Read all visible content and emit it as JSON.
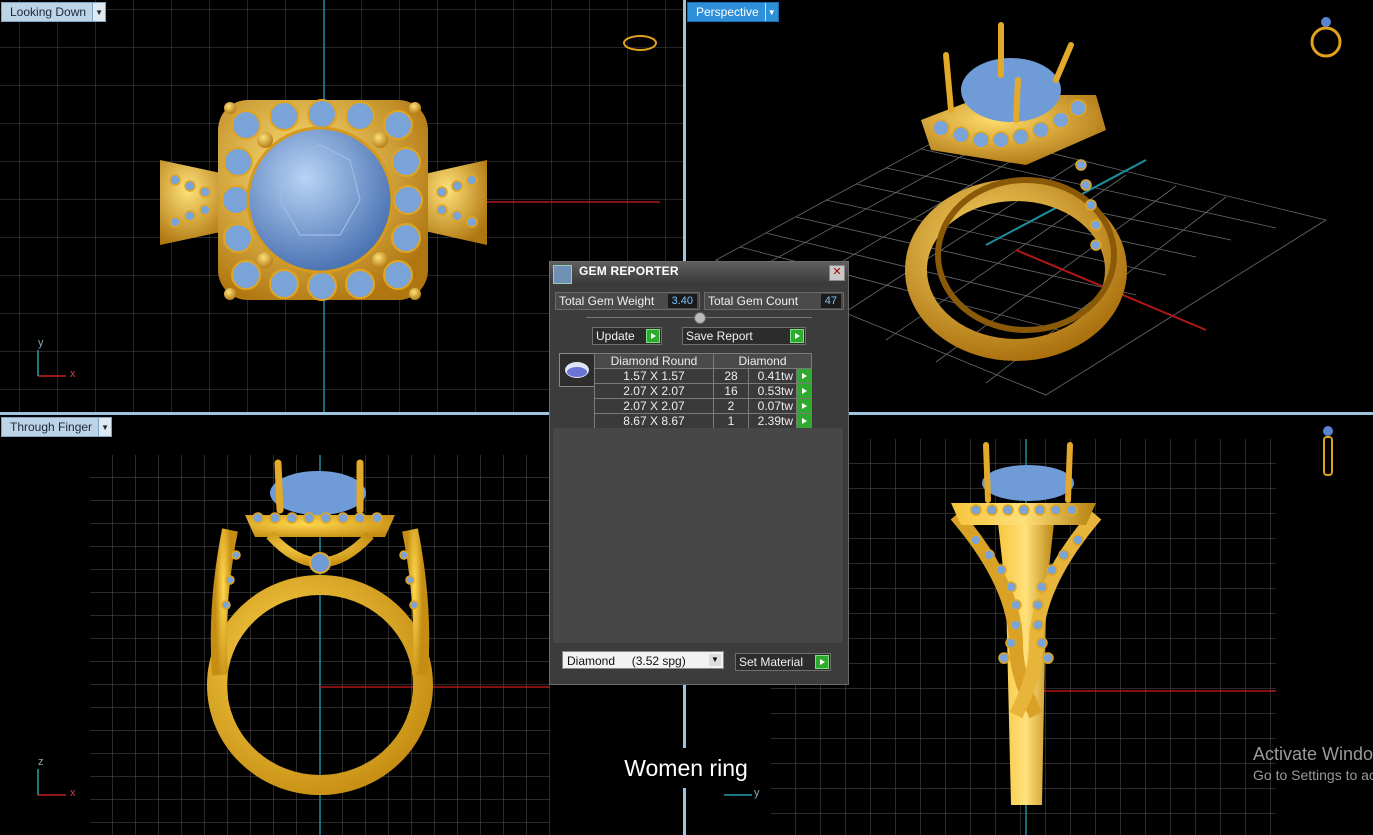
{
  "viewports": {
    "top": {
      "label": "Looking Down"
    },
    "perspective": {
      "label": "Perspective"
    },
    "front": {
      "label": "Through Finger"
    },
    "side": {
      "label": ""
    }
  },
  "axes": {
    "top": {
      "x": "x",
      "y": "y"
    },
    "front": {
      "x": "x",
      "z": "z"
    },
    "side": {
      "y": "y"
    }
  },
  "gem_reporter": {
    "title": "GEM REPORTER",
    "total_weight_label": "Total Gem Weight",
    "total_weight_value": "3.40",
    "total_count_label": "Total Gem Count",
    "total_count_value": "47",
    "update_label": "Update",
    "save_report_label": "Save Report",
    "table": {
      "headers": [
        "Diamond Round",
        "Diamond"
      ],
      "rows": [
        {
          "size": "1.57 X 1.57",
          "count": "28",
          "weight": "0.41tw"
        },
        {
          "size": "2.07 X 2.07",
          "count": "16",
          "weight": "0.53tw"
        },
        {
          "size": "2.07 X 2.07",
          "count": "2",
          "weight": "0.07tw"
        },
        {
          "size": "8.67 X 8.67",
          "count": "1",
          "weight": "2.39tw"
        }
      ]
    },
    "material_select": "Diamond     (3.52 spg)",
    "set_material_label": "Set Material"
  },
  "caption": "Women ring",
  "watermark": {
    "line1": "Activate Windows",
    "line2": "Go to Settings to activate Windows."
  },
  "colors": {
    "gold": "#e0a21a",
    "gem": "#6f9bd6",
    "grid": "#555555",
    "label_blue": "#2f8fd8"
  }
}
